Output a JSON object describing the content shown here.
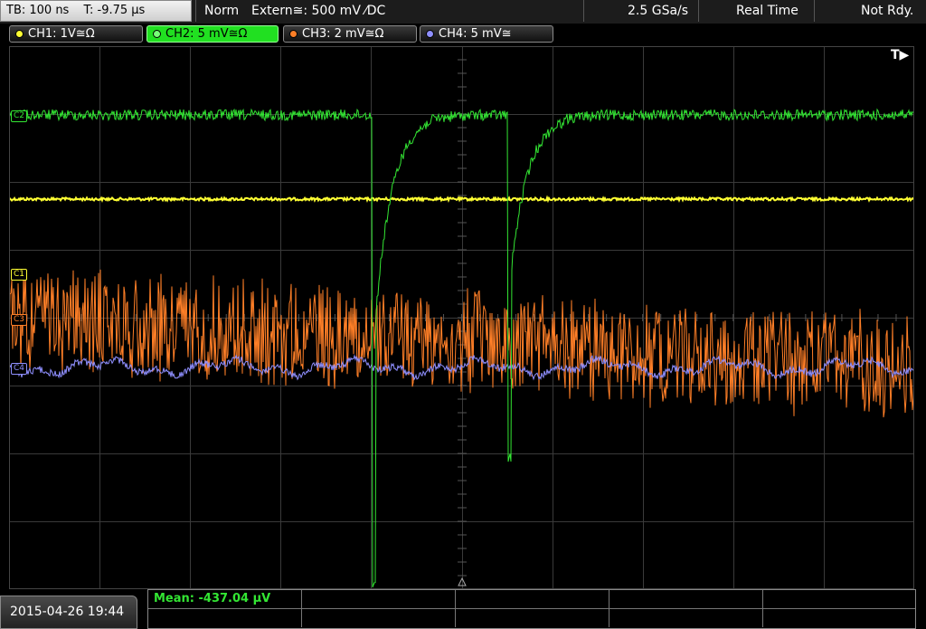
{
  "topbar": {
    "timebase": "TB: 100 ns",
    "trigger_offset": "T: -9.75 µs",
    "mode": "Norm",
    "trigger_source": "Extern≅: 500 mV ⁄DC",
    "sample_rate": "2.5 GSa/s",
    "acq_mode": "Real Time",
    "status": "Not Rdy."
  },
  "channels": [
    {
      "label": "CH1: 1V≅Ω",
      "color": "#ffff33"
    },
    {
      "label": "CH2: 5 mV≅Ω",
      "color": "#33e633",
      "active": true
    },
    {
      "label": "CH3: 2 mV≅Ω",
      "color": "#ff7f27"
    },
    {
      "label": "CH4: 5 mV≅",
      "color": "#8f8fff"
    }
  ],
  "markers": {
    "c1": "C1",
    "c2": "C2",
    "c3": "C3",
    "c4": "C4"
  },
  "trigger_indicator": "T▶",
  "footer": {
    "datetime": "2015-04-26 19:44",
    "measurement": "Mean: -437.04 µV"
  },
  "colors": {
    "ch1": "#ffff33",
    "ch2": "#33e633",
    "ch3": "#ff7f27",
    "ch4": "#8f8fff",
    "grid": "#3a3a3a"
  }
}
